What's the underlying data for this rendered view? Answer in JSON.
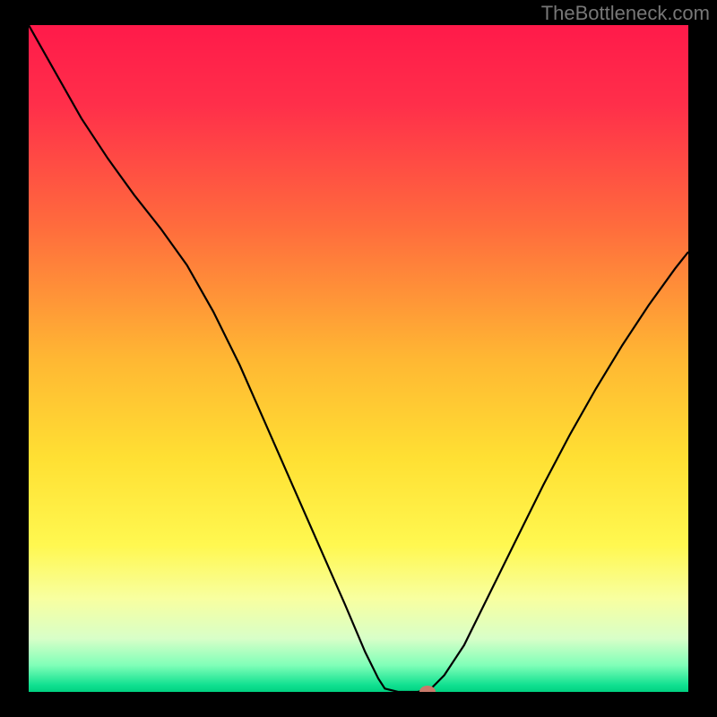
{
  "watermark": "TheBottleneck.com",
  "chart_data": {
    "type": "line",
    "title": "",
    "xlabel": "",
    "ylabel": "",
    "xlim": [
      0,
      100
    ],
    "ylim": [
      0,
      100
    ],
    "gradient_stops": [
      {
        "pos": 0,
        "color": "#ff1a4a"
      },
      {
        "pos": 12,
        "color": "#ff2f4a"
      },
      {
        "pos": 30,
        "color": "#ff6b3d"
      },
      {
        "pos": 50,
        "color": "#ffb733"
      },
      {
        "pos": 65,
        "color": "#ffe033"
      },
      {
        "pos": 78,
        "color": "#fff850"
      },
      {
        "pos": 86,
        "color": "#f8ffa0"
      },
      {
        "pos": 92,
        "color": "#d8ffc8"
      },
      {
        "pos": 96,
        "color": "#80ffb8"
      },
      {
        "pos": 99,
        "color": "#10e090"
      },
      {
        "pos": 100,
        "color": "#00d080"
      }
    ],
    "series": [
      {
        "name": "bottleneck-curve",
        "points": [
          {
            "x": 0,
            "y": 100
          },
          {
            "x": 4,
            "y": 93
          },
          {
            "x": 8,
            "y": 86
          },
          {
            "x": 12,
            "y": 80
          },
          {
            "x": 16,
            "y": 74.5
          },
          {
            "x": 20,
            "y": 69.5
          },
          {
            "x": 24,
            "y": 64
          },
          {
            "x": 28,
            "y": 57
          },
          {
            "x": 32,
            "y": 49
          },
          {
            "x": 36,
            "y": 40
          },
          {
            "x": 40,
            "y": 31
          },
          {
            "x": 44,
            "y": 22
          },
          {
            "x": 48,
            "y": 13
          },
          {
            "x": 51,
            "y": 6
          },
          {
            "x": 53,
            "y": 2
          },
          {
            "x": 54,
            "y": 0.5
          },
          {
            "x": 56,
            "y": 0
          },
          {
            "x": 59,
            "y": 0
          },
          {
            "x": 61,
            "y": 0.5
          },
          {
            "x": 63,
            "y": 2.5
          },
          {
            "x": 66,
            "y": 7
          },
          {
            "x": 70,
            "y": 15
          },
          {
            "x": 74,
            "y": 23
          },
          {
            "x": 78,
            "y": 31
          },
          {
            "x": 82,
            "y": 38.5
          },
          {
            "x": 86,
            "y": 45.5
          },
          {
            "x": 90,
            "y": 52
          },
          {
            "x": 94,
            "y": 58
          },
          {
            "x": 98,
            "y": 63.5
          },
          {
            "x": 100,
            "y": 66
          }
        ]
      }
    ],
    "marker": {
      "x": 60.5,
      "y": 0
    }
  }
}
